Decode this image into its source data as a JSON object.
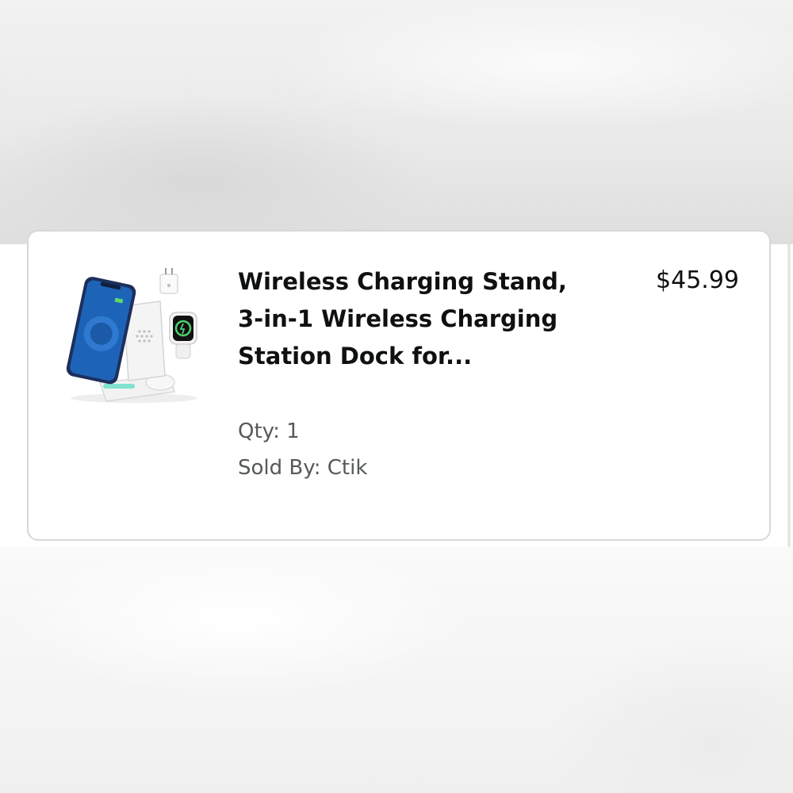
{
  "order_item": {
    "title": "Wireless Charging Stand, 3-in-1 Wireless Charging Station Dock for...",
    "price": "$45.99",
    "qty_label": "Qty: 1",
    "sold_by_label": "Sold By: Ctik",
    "image_icon": "product-image-wireless-charging-stand"
  },
  "colors": {
    "card_border": "#d5d9d9",
    "text_primary": "#0f1111",
    "text_secondary": "#565959"
  }
}
